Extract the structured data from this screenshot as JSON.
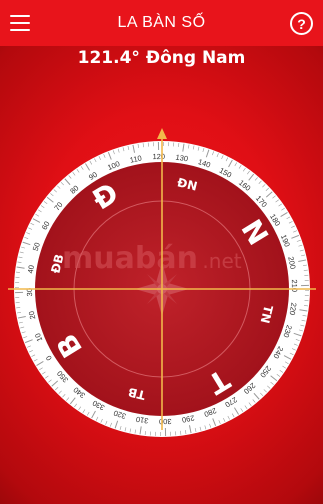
{
  "header": {
    "title": "LA BÀN SỐ",
    "menu_icon": "hamburger-menu-icon",
    "help_icon": "question-circle-icon",
    "help_glyph": "?"
  },
  "heading_text": "121.4° Đông Nam",
  "compass": {
    "heading_deg": 121.4,
    "major_labels": [
      {
        "label": "Đ",
        "deg": 90
      },
      {
        "label": "N",
        "deg": 180
      },
      {
        "label": "T",
        "deg": 270
      },
      {
        "label": "B",
        "deg": 0
      }
    ],
    "minor_labels": [
      {
        "label": "ĐN",
        "deg": 135
      },
      {
        "label": "TN",
        "deg": 225
      },
      {
        "label": "TB",
        "deg": 315
      },
      {
        "label": "ĐB",
        "deg": 45
      }
    ],
    "degree_labels": [
      "0",
      "10",
      "20",
      "30",
      "40",
      "50",
      "60",
      "70",
      "80",
      "90",
      "100",
      "110",
      "120",
      "130",
      "140",
      "150",
      "160",
      "170",
      "180",
      "190",
      "200",
      "210",
      "220",
      "230",
      "240",
      "250",
      "260",
      "270",
      "280",
      "290",
      "300",
      "310",
      "320",
      "330",
      "340",
      "350"
    ]
  },
  "watermark": {
    "brand": "muabán",
    "suffix": ".net"
  },
  "colors": {
    "accent_red": "#e8141b",
    "dial_red": "#b0161f",
    "crosshair": "#f2b84b",
    "text_white": "#ffffff"
  }
}
